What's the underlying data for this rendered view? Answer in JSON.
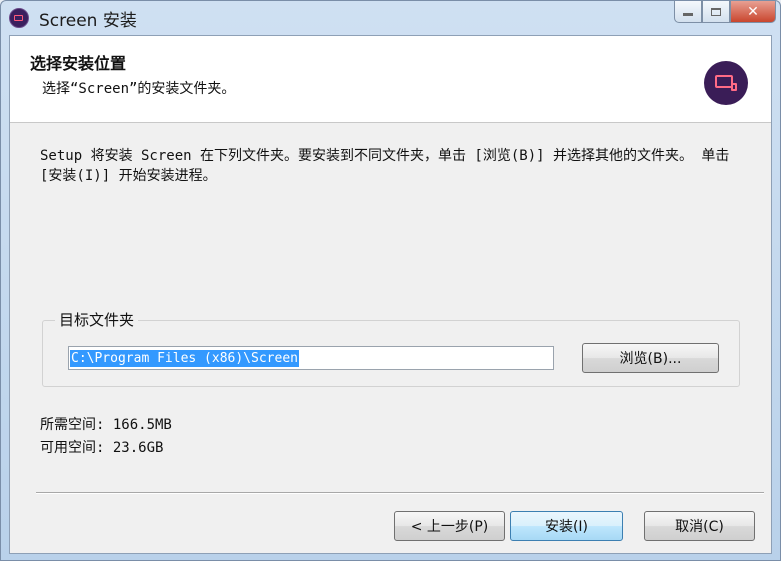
{
  "window": {
    "title": "Screen 安装",
    "controls": {
      "minimize": "minimize",
      "maximize": "maximize",
      "close": "✕"
    }
  },
  "header": {
    "title": "选择安装位置",
    "subtitle": "选择“Screen”的安装文件夹。",
    "logo": "screen-logo-icon"
  },
  "description": "Setup 将安装 Screen 在下列文件夹。要安装到不同文件夹，单击 [浏览(B)] 并选择其他的文件夹。 单击 [安装(I)] 开始安装进程。",
  "destination": {
    "legend": "目标文件夹",
    "path": "C:\\Program Files (x86)\\Screen",
    "browse_label": "浏览(B)..."
  },
  "space": {
    "required": "所需空间: 166.5MB",
    "available": "可用空间: 23.6GB"
  },
  "buttons": {
    "back": "< 上一步(P)",
    "install": "安装(I)",
    "cancel": "取消(C)"
  },
  "colors": {
    "accent": "#3399ff",
    "logo_bg": "#3a1d57",
    "logo_fg": "#ff6b86"
  }
}
